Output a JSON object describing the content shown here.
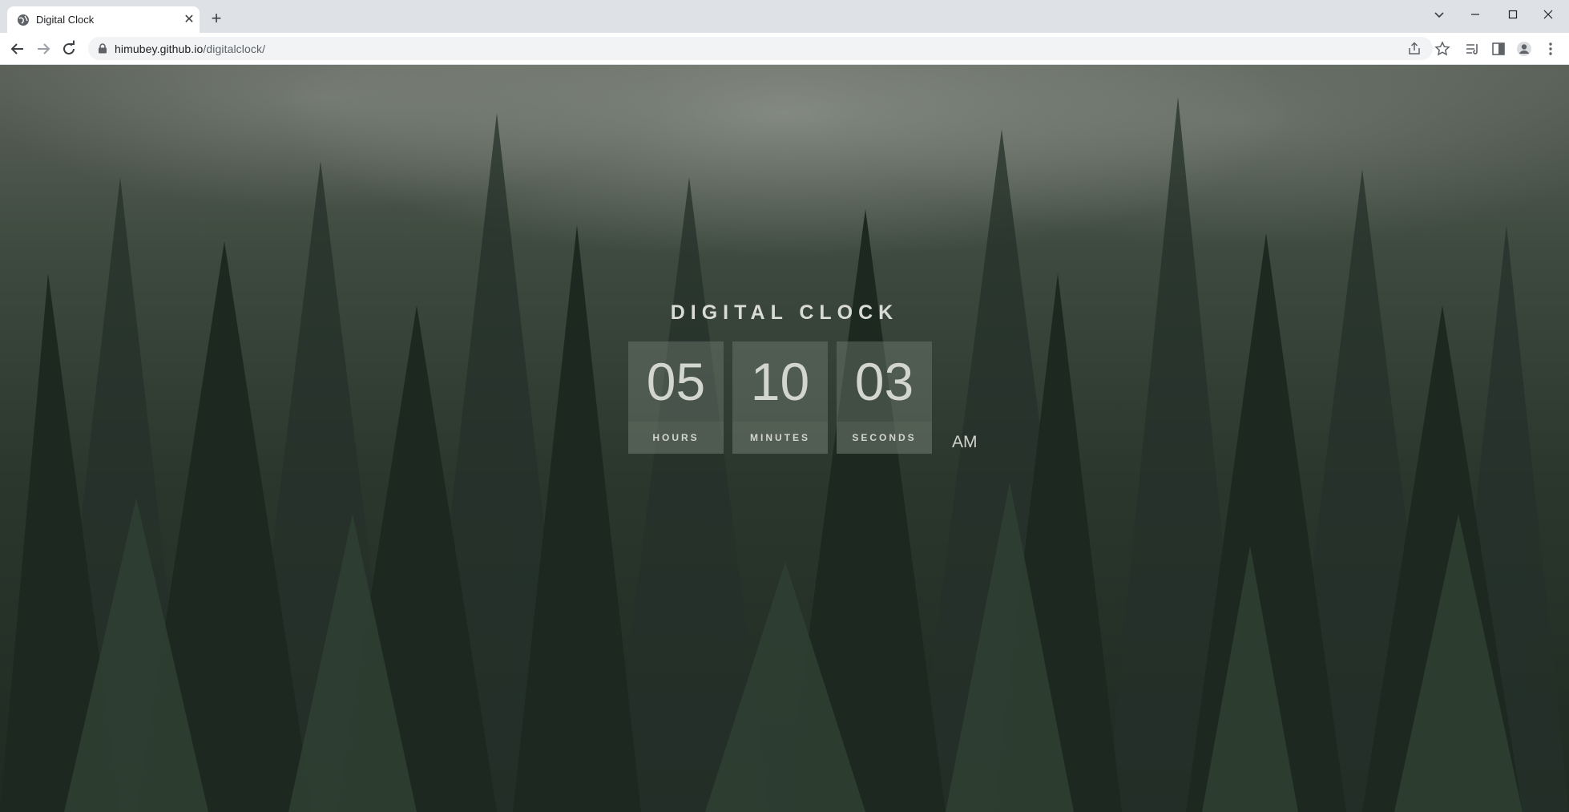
{
  "browser": {
    "tab": {
      "title": "Digital Clock"
    },
    "address_bar": {
      "host": "himubey.github.io",
      "path": "/digitalclock/"
    }
  },
  "clock": {
    "title": "DIGITAL CLOCK",
    "hours": {
      "value": "05",
      "label": "HOURS"
    },
    "minutes": {
      "value": "10",
      "label": "MINUTES"
    },
    "seconds": {
      "value": "03",
      "label": "SECONDS"
    },
    "period": "AM"
  },
  "colors": {
    "tabstrip": "#dee1e6",
    "toolbar": "#ffffff",
    "omnibox": "#f1f3f4",
    "clock_text": "#d9dcd6"
  }
}
